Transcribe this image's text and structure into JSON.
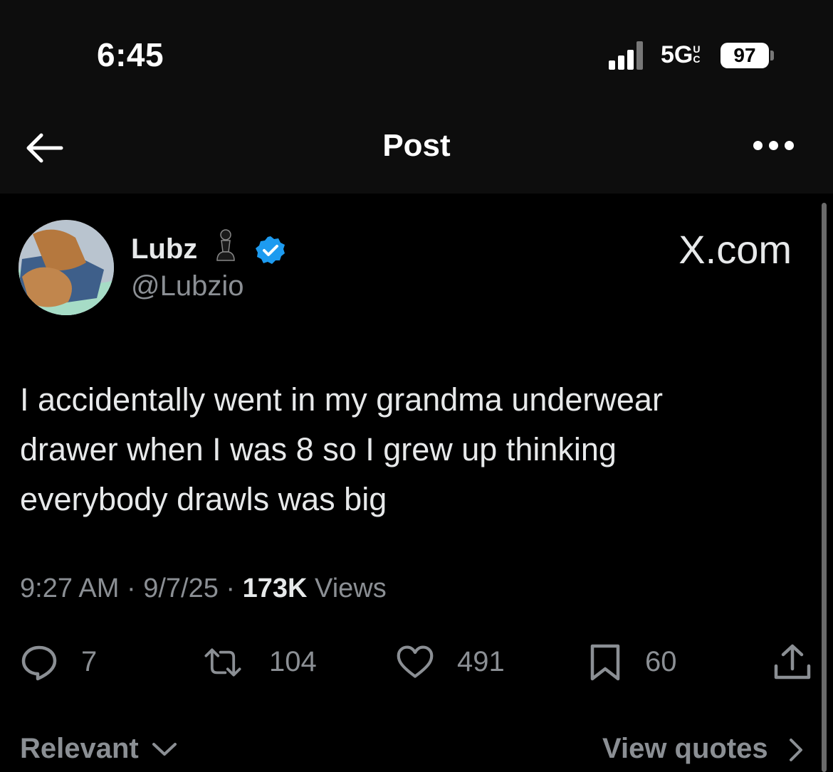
{
  "status_bar": {
    "time": "6:45",
    "network": "5G",
    "network_suffix": "UC",
    "battery": "97"
  },
  "header": {
    "title": "Post",
    "back_icon": "arrow-left-icon",
    "more_icon": "more-horizontal-icon"
  },
  "author": {
    "name": "Lubz",
    "name_emoji": "chess-pawn-icon",
    "verified_icon": "verified-badge-icon",
    "handle": "@Lubzio",
    "brand": "X.com"
  },
  "post": {
    "lines": [
      "I accidentally went in my grandma underwear",
      "drawer when I was 8 so I grew up thinking",
      "everybody drawls was big"
    ],
    "time": "9:27 AM",
    "date": "9/7/25",
    "views_count": "173K",
    "views_label": "Views",
    "separator": "·"
  },
  "actions": {
    "replies": "7",
    "reposts": "104",
    "likes": "491",
    "bookmarks": "60"
  },
  "footer": {
    "sort_label": "Relevant",
    "quotes_label": "View quotes"
  },
  "colors": {
    "background": "#000000",
    "text": "#e7e9ea",
    "muted": "#8b8f94",
    "verified": "#1d9bf0"
  }
}
